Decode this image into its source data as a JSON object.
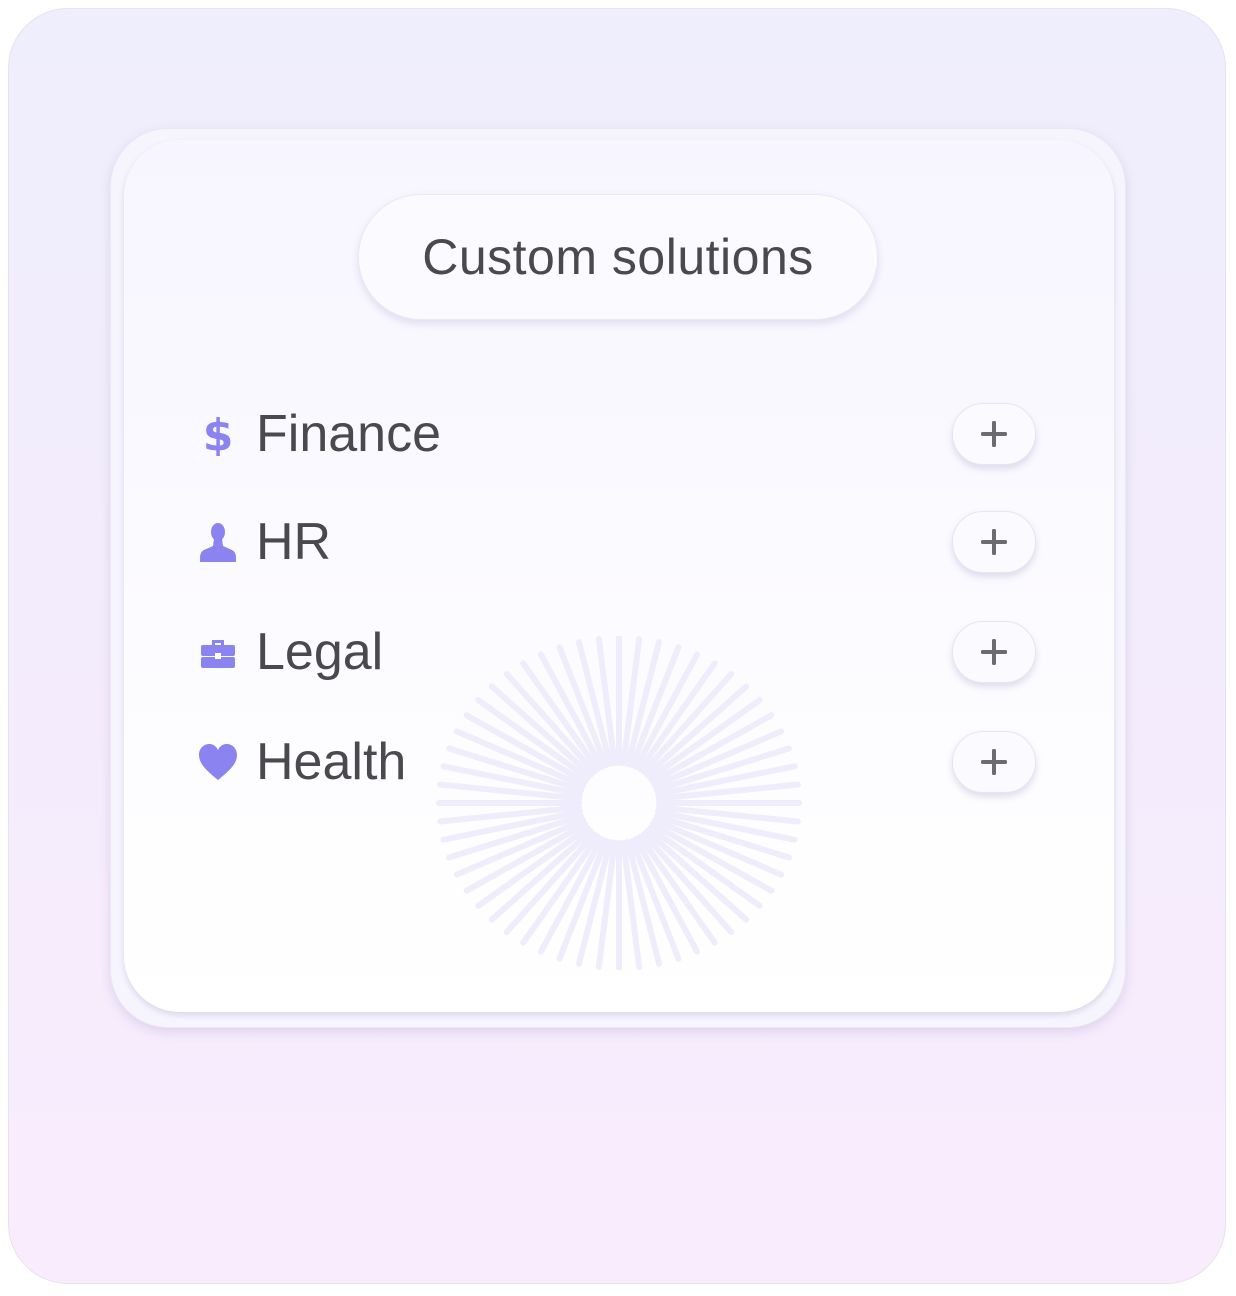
{
  "header": {
    "title": "Custom solutions"
  },
  "colors": {
    "accent": "#8b84f0",
    "text": "#4a4a4e",
    "plus": "#6b6b70"
  },
  "items": [
    {
      "label": "Finance",
      "icon": "dollar-icon"
    },
    {
      "label": "HR",
      "icon": "person-icon"
    },
    {
      "label": "Legal",
      "icon": "briefcase-icon"
    },
    {
      "label": "Health",
      "icon": "heart-icon"
    }
  ],
  "add_button": {
    "icon": "plus-icon"
  }
}
